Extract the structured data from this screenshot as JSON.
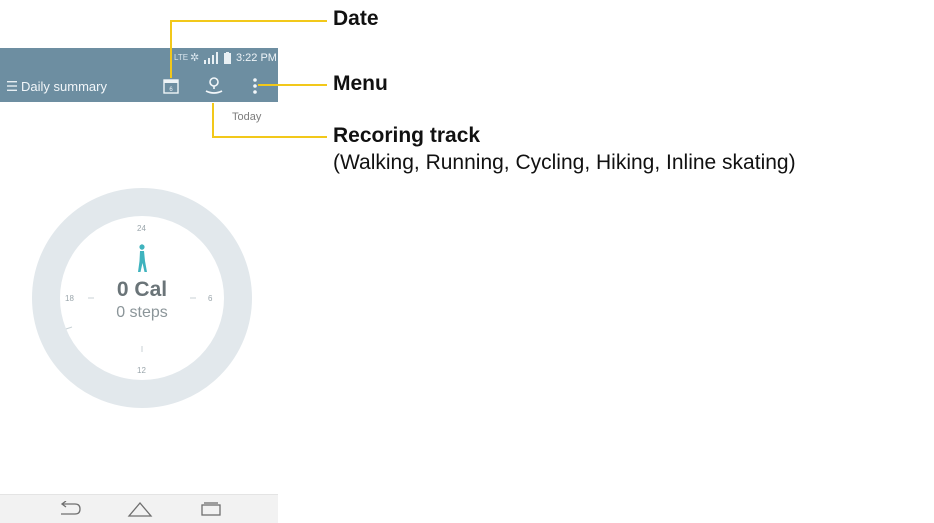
{
  "status_bar": {
    "network": "LTE",
    "time": "3:22 PM"
  },
  "action_bar": {
    "title": "Daily summary",
    "calendar_day": "6"
  },
  "day_label": "Today",
  "dial": {
    "labels": {
      "top": "24",
      "right": "6",
      "bottom": "12",
      "left": "18"
    },
    "calories": "0 Cal",
    "steps": "0 steps"
  },
  "callouts": {
    "date": "Date",
    "menu": "Menu",
    "recording_track": "Recoring track",
    "recording_track_detail": "(Walking, Running, Cycling, Hiking, Inline skating)"
  },
  "colors": {
    "action_bar": "#6d8ea1",
    "callout_line": "#f2c81a",
    "ring": "#dfe6ea",
    "figure": "#3fb3be"
  },
  "icons": [
    "menu-icon",
    "calendar-icon",
    "recording-track-icon",
    "overflow-menu-icon",
    "walking-figure-icon",
    "back-icon",
    "home-icon",
    "recent-apps-icon"
  ]
}
